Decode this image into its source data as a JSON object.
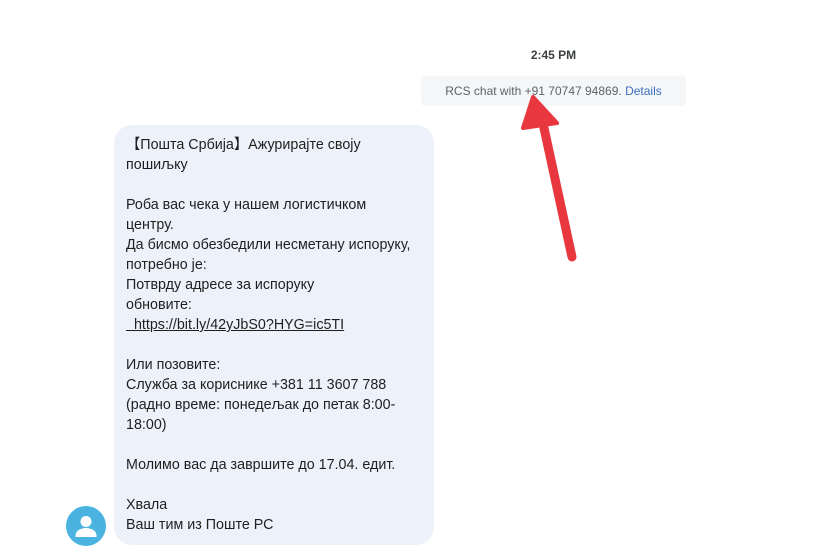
{
  "conversation": {
    "timestamp": "2:45 PM",
    "rcs_info": {
      "text": "RCS chat with +91 70747 94869.",
      "details_link": "Details"
    },
    "message": {
      "lines": [
        "【Пошта Србија】Ажурирајте своју",
        "пошиљку",
        "",
        "Роба вас чека у нашем логистичком",
        "центру.",
        "Да бисмо обезбедили несметану испоруку,",
        "потребно је:",
        "Потврду адресе за испоруку",
        "обновите:",
        "  https://bit.ly/42yJbS0?HYG=ic5TI",
        "",
        "Или позовите:",
        "Служба за кориснике +381 11 3607 788",
        "(радно време: понедељак до петак 8:00-",
        "18:00)",
        "",
        "Молимо вас да завршите до 17.04. едит.",
        "",
        "Хвала",
        "Ваш тим из Поште РС"
      ]
    }
  },
  "colors": {
    "bubble_bg": "#edf2fa",
    "info_bg": "#f5f6f8",
    "details_link": "#3c6fbf",
    "avatar": "#4bb3e0",
    "annotation_arrow": "#e8373e"
  },
  "icons": {
    "avatar": "person-icon",
    "annotation": "arrow-icon"
  }
}
